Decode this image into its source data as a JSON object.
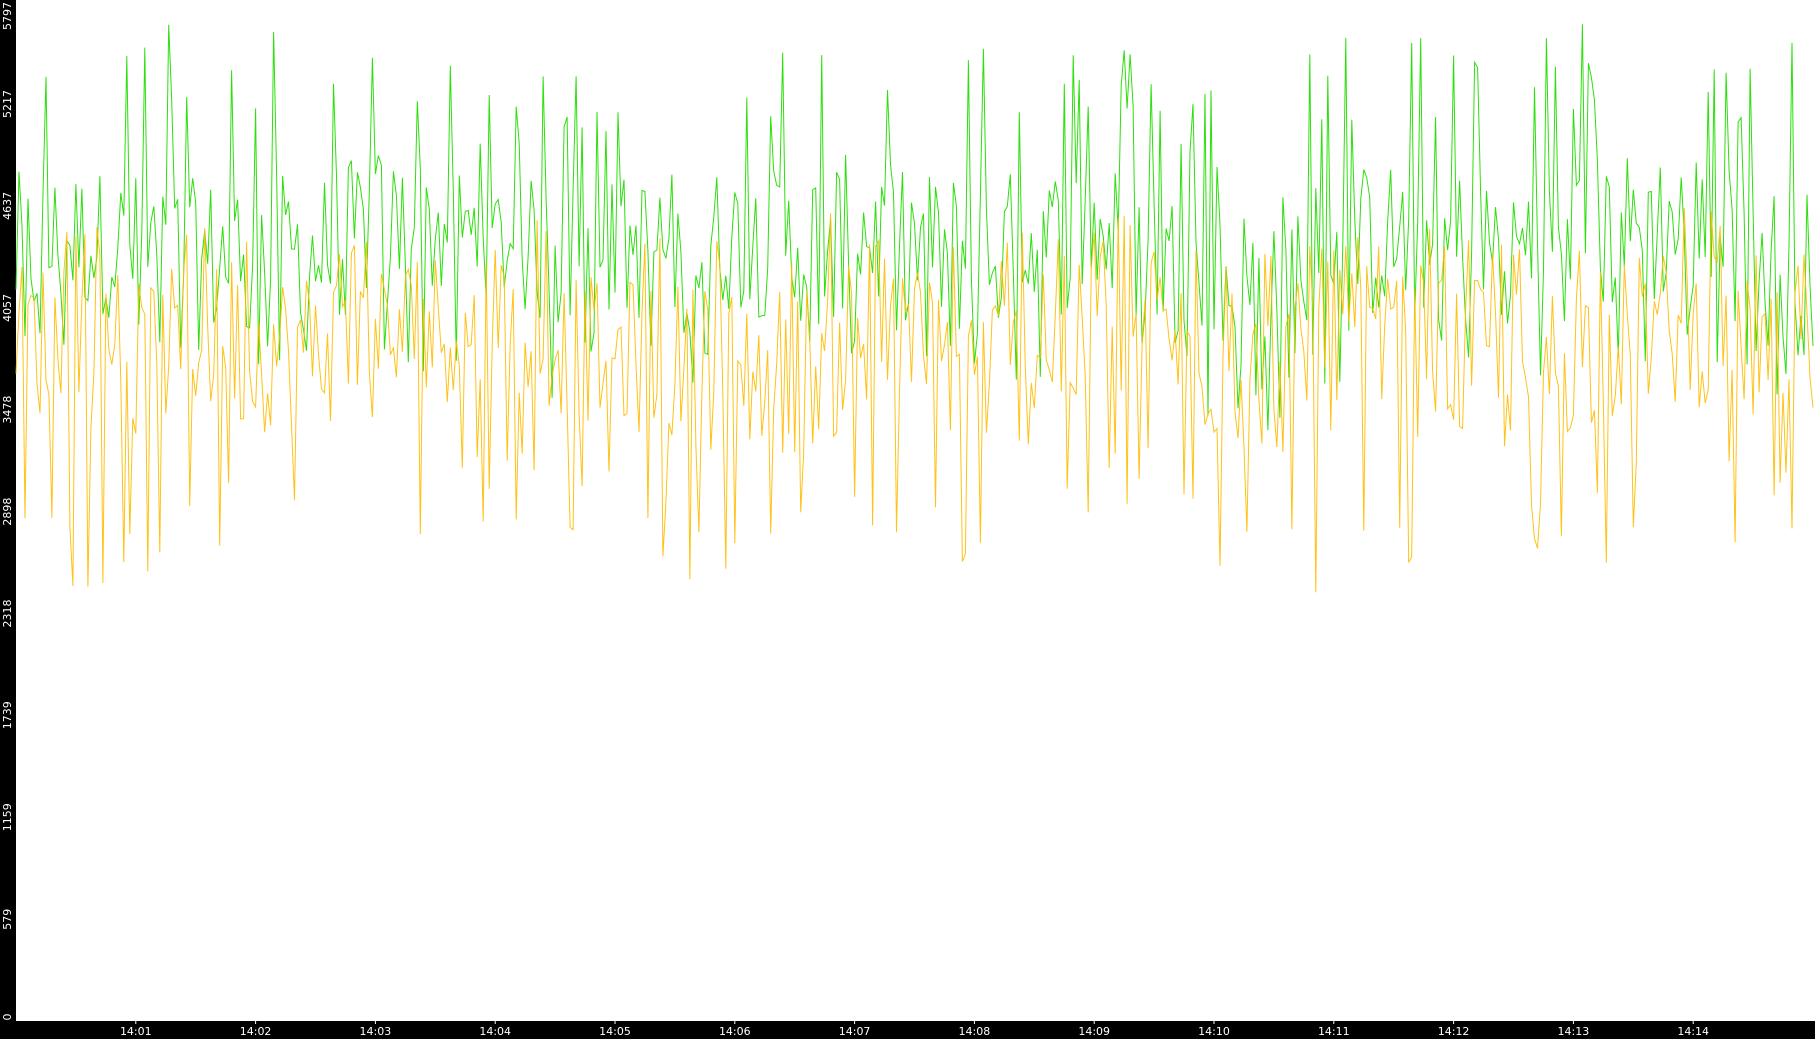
{
  "chart_data": {
    "type": "line",
    "title": "",
    "xlabel": "",
    "ylabel": "",
    "grid": false,
    "legend": "none",
    "ylim": [
      0,
      5797
    ],
    "xlim": [
      "14:00:00",
      "14:15:00"
    ],
    "y_ticks": [
      "0",
      "579",
      "1159",
      "1739",
      "2318",
      "2898",
      "3478",
      "4057",
      "4637",
      "5217",
      "5797"
    ],
    "x_ticks": [
      {
        "label": "14:01",
        "t": "14:01:00"
      },
      {
        "label": "14:02",
        "t": "14:02:00"
      },
      {
        "label": "14:03",
        "t": "14:03:00"
      },
      {
        "label": "14:04",
        "t": "14:04:00"
      },
      {
        "label": "14:05",
        "t": "14:05:00"
      },
      {
        "label": "14:06",
        "t": "14:06:00"
      },
      {
        "label": "14:07",
        "t": "14:07:00"
      },
      {
        "label": "14:08",
        "t": "14:08:00"
      },
      {
        "label": "14:09",
        "t": "14:09:00"
      },
      {
        "label": "14:10",
        "t": "14:10:00"
      },
      {
        "label": "14:11",
        "t": "14:11:00"
      },
      {
        "label": "14:12",
        "t": "14:12:00"
      },
      {
        "label": "14:13",
        "t": "14:13:00"
      },
      {
        "label": "14:14",
        "t": "14:14:00"
      }
    ],
    "series": [
      {
        "color": "#22dd00",
        "x": [
          "14:00:00",
          "14:00:30",
          "14:01:00",
          "14:01:30",
          "14:02:00",
          "14:02:30",
          "14:03:00",
          "14:03:30",
          "14:04:00",
          "14:04:30",
          "14:05:00",
          "14:05:30",
          "14:06:00",
          "14:06:30",
          "14:07:00",
          "14:07:30",
          "14:08:00",
          "14:08:30",
          "14:09:00",
          "14:09:30",
          "14:10:00",
          "14:10:30",
          "14:11:00",
          "14:11:30",
          "14:12:00",
          "14:12:30",
          "14:13:00",
          "14:13:30",
          "14:14:00",
          "14:14:30",
          "14:15:00"
        ],
        "low": [
          3550,
          3800,
          3850,
          3450,
          3700,
          3650,
          3800,
          3650,
          3750,
          3500,
          3750,
          3600,
          3700,
          3650,
          3750,
          3700,
          3550,
          3650,
          3700,
          3600,
          3300,
          3350,
          3600,
          3700,
          3650,
          3650,
          3700,
          3700,
          3750,
          3450,
          3500
        ],
        "mid": [
          4350,
          4450,
          4400,
          4300,
          4400,
          4350,
          4550,
          4500,
          4450,
          4350,
          4400,
          4400,
          4450,
          4400,
          4500,
          4400,
          4350,
          4400,
          4500,
          4350,
          4150,
          4200,
          4400,
          4450,
          4400,
          4400,
          4450,
          4500,
          4550,
          4300,
          4250
        ],
        "high": [
          5700,
          5650,
          5780,
          5650,
          5700,
          5680,
          5650,
          5500,
          5250,
          5500,
          5580,
          5600,
          5550,
          5650,
          5720,
          5650,
          5780,
          5630,
          5580,
          5550,
          5400,
          5600,
          5650,
          5700,
          5700,
          5650,
          5700,
          5780,
          5680,
          5650,
          5600
        ]
      },
      {
        "color": "#ffbb00",
        "x": [
          "14:00:00",
          "14:00:30",
          "14:01:00",
          "14:01:30",
          "14:02:00",
          "14:02:30",
          "14:03:00",
          "14:03:30",
          "14:04:00",
          "14:04:30",
          "14:05:00",
          "14:05:30",
          "14:06:00",
          "14:06:30",
          "14:07:00",
          "14:07:30",
          "14:08:00",
          "14:08:30",
          "14:09:00",
          "14:09:30",
          "14:10:00",
          "14:10:30",
          "14:11:00",
          "14:11:30",
          "14:12:00",
          "14:12:30",
          "14:13:00",
          "14:13:30",
          "14:14:00",
          "14:14:30",
          "14:15:00"
        ],
        "low": [
          2650,
          2450,
          2500,
          2700,
          2500,
          2600,
          2450,
          2650,
          2800,
          2800,
          2550,
          2500,
          2300,
          2350,
          2650,
          2600,
          2450,
          2400,
          2700,
          2900,
          2550,
          2350,
          2400,
          2500,
          2400,
          2250,
          2500,
          2600,
          2700,
          2650,
          2600
        ],
        "mid": [
          3900,
          3850,
          3750,
          3900,
          3800,
          3850,
          3850,
          3950,
          4000,
          3850,
          3800,
          3750,
          3700,
          3700,
          3800,
          3850,
          3700,
          3750,
          3900,
          3950,
          3700,
          3650,
          3850,
          3800,
          3750,
          3700,
          3800,
          3900,
          3950,
          3800,
          3700
        ],
        "high": [
          4600,
          4550,
          4500,
          4650,
          4550,
          4600,
          4600,
          4650,
          4700,
          4550,
          4500,
          4550,
          4450,
          4600,
          4600,
          4550,
          4450,
          4550,
          4600,
          4650,
          4450,
          4400,
          4600,
          4550,
          4500,
          4450,
          4550,
          4650,
          4700,
          4500,
          4450
        ]
      }
    ]
  }
}
